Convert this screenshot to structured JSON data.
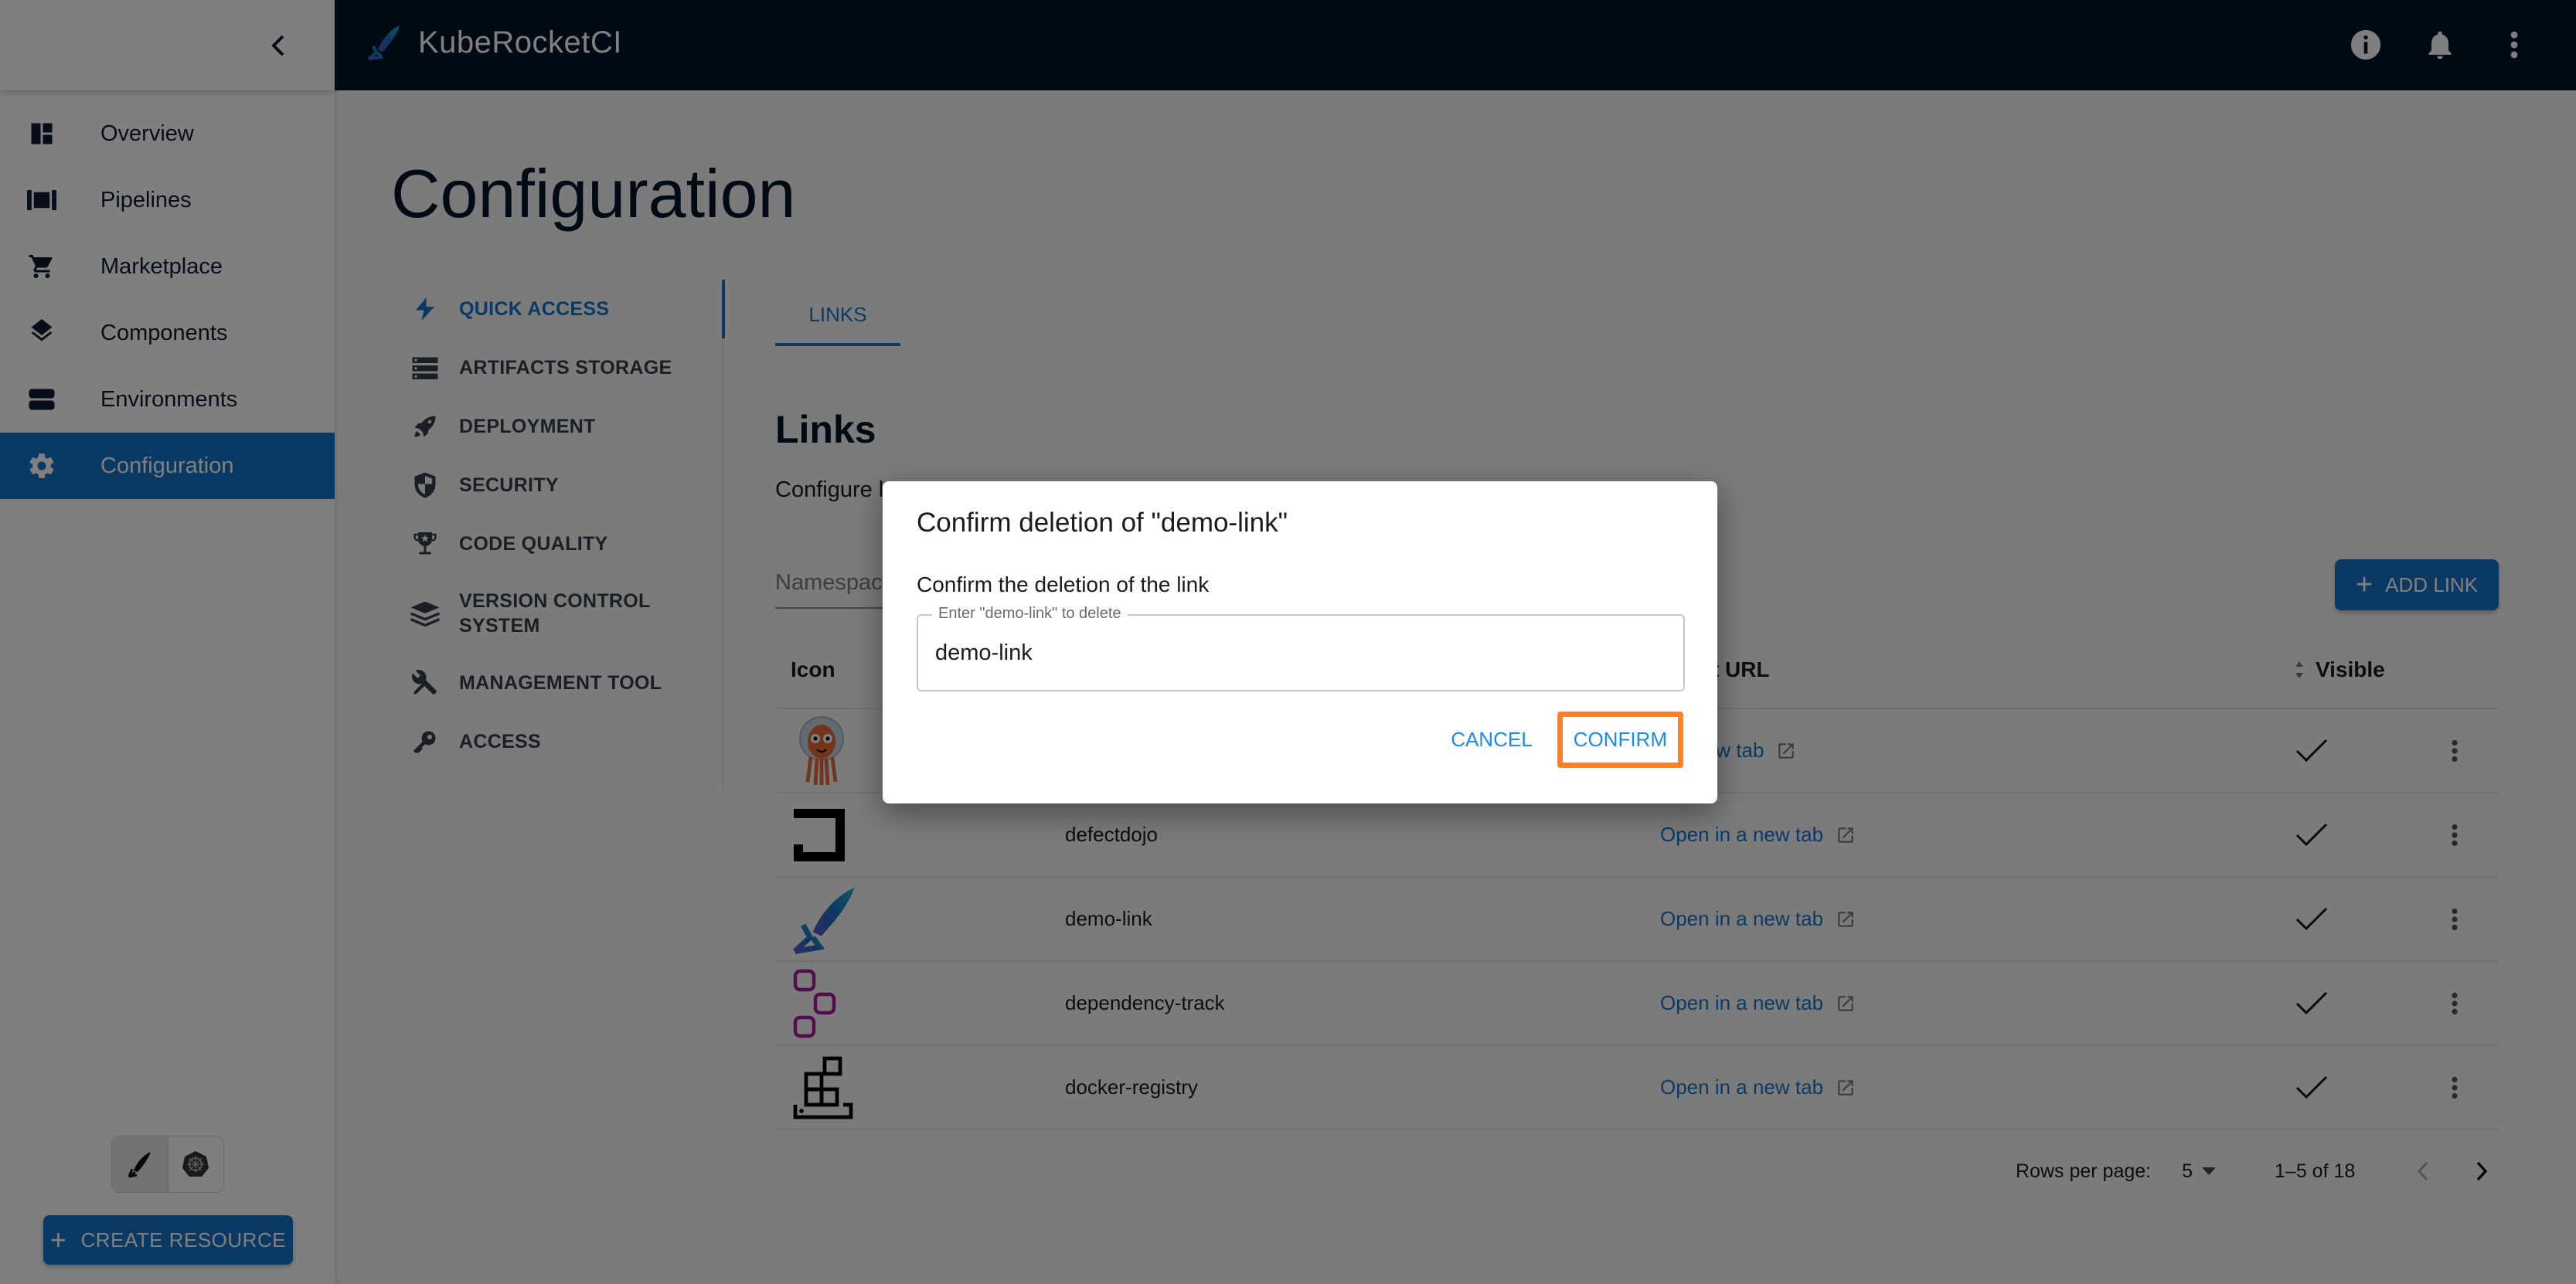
{
  "app": {
    "brand_name": "KubeRocketCI",
    "header_icons": [
      "info-icon",
      "bell-icon",
      "more-vert-icon"
    ]
  },
  "sidebar": {
    "items": [
      {
        "label": "Overview",
        "icon": "dashboard-icon",
        "active": false
      },
      {
        "label": "Pipelines",
        "icon": "pipelines-icon",
        "active": false
      },
      {
        "label": "Marketplace",
        "icon": "cart-icon",
        "active": false
      },
      {
        "label": "Components",
        "icon": "layers-icon",
        "active": false
      },
      {
        "label": "Environments",
        "icon": "environments-icon",
        "active": false
      },
      {
        "label": "Configuration",
        "icon": "gear-icon",
        "active": true
      }
    ],
    "create_resource_label": "CREATE RESOURCE"
  },
  "page": {
    "title": "Configuration"
  },
  "subnav": {
    "items": [
      {
        "label": "QUICK ACCESS",
        "icon": "bolt-icon",
        "active": true
      },
      {
        "label": "ARTIFACTS STORAGE",
        "icon": "storage-icon",
        "active": false
      },
      {
        "label": "DEPLOYMENT",
        "icon": "rocket-icon",
        "active": false
      },
      {
        "label": "SECURITY",
        "icon": "shield-icon",
        "active": false
      },
      {
        "label": "CODE QUALITY",
        "icon": "trophy-icon",
        "active": false
      },
      {
        "label": "VERSION CONTROL SYSTEM",
        "icon": "stack-icon",
        "active": false
      },
      {
        "label": "MANAGEMENT TOOL",
        "icon": "tools-icon",
        "active": false
      },
      {
        "label": "ACCESS",
        "icon": "key-icon",
        "active": false
      }
    ]
  },
  "tabs": [
    {
      "label": "LINKS",
      "active": true
    }
  ],
  "links_section": {
    "title": "Links",
    "description": "Configure l",
    "namespace_placeholder": "Namespac",
    "add_link_label": "ADD LINK"
  },
  "table": {
    "columns": {
      "icon": "Icon",
      "url": "onent URL",
      "visible": "Visible"
    },
    "rows": [
      {
        "name": "",
        "url_label": "n a new tab",
        "visible": true,
        "icon": "argocd-icon"
      },
      {
        "name": "defectdojo",
        "url_label": "Open in a new tab",
        "visible": true,
        "icon": "defectdojo-icon"
      },
      {
        "name": "demo-link",
        "url_label": "Open in a new tab",
        "visible": true,
        "icon": "kuberocketci-icon"
      },
      {
        "name": "dependency-track",
        "url_label": "Open in a new tab",
        "visible": true,
        "icon": "dependency-track-icon"
      },
      {
        "name": "docker-registry",
        "url_label": "Open in a new tab",
        "visible": true,
        "icon": "docker-registry-icon"
      }
    ]
  },
  "pagination": {
    "rows_per_page_label": "Rows per page:",
    "rows_per_page_value": "5",
    "range": "1–5 of 18"
  },
  "dialog": {
    "title": "Confirm deletion of \"demo-link\"",
    "text": "Confirm the deletion of the link",
    "field_label": "Enter \"demo-link\" to delete",
    "field_value": "demo-link",
    "cancel_label": "CANCEL",
    "confirm_label": "CONFIRM"
  },
  "colors": {
    "primary": "#1474c9",
    "navbar": "#001529",
    "highlight": "#ff7f22"
  }
}
